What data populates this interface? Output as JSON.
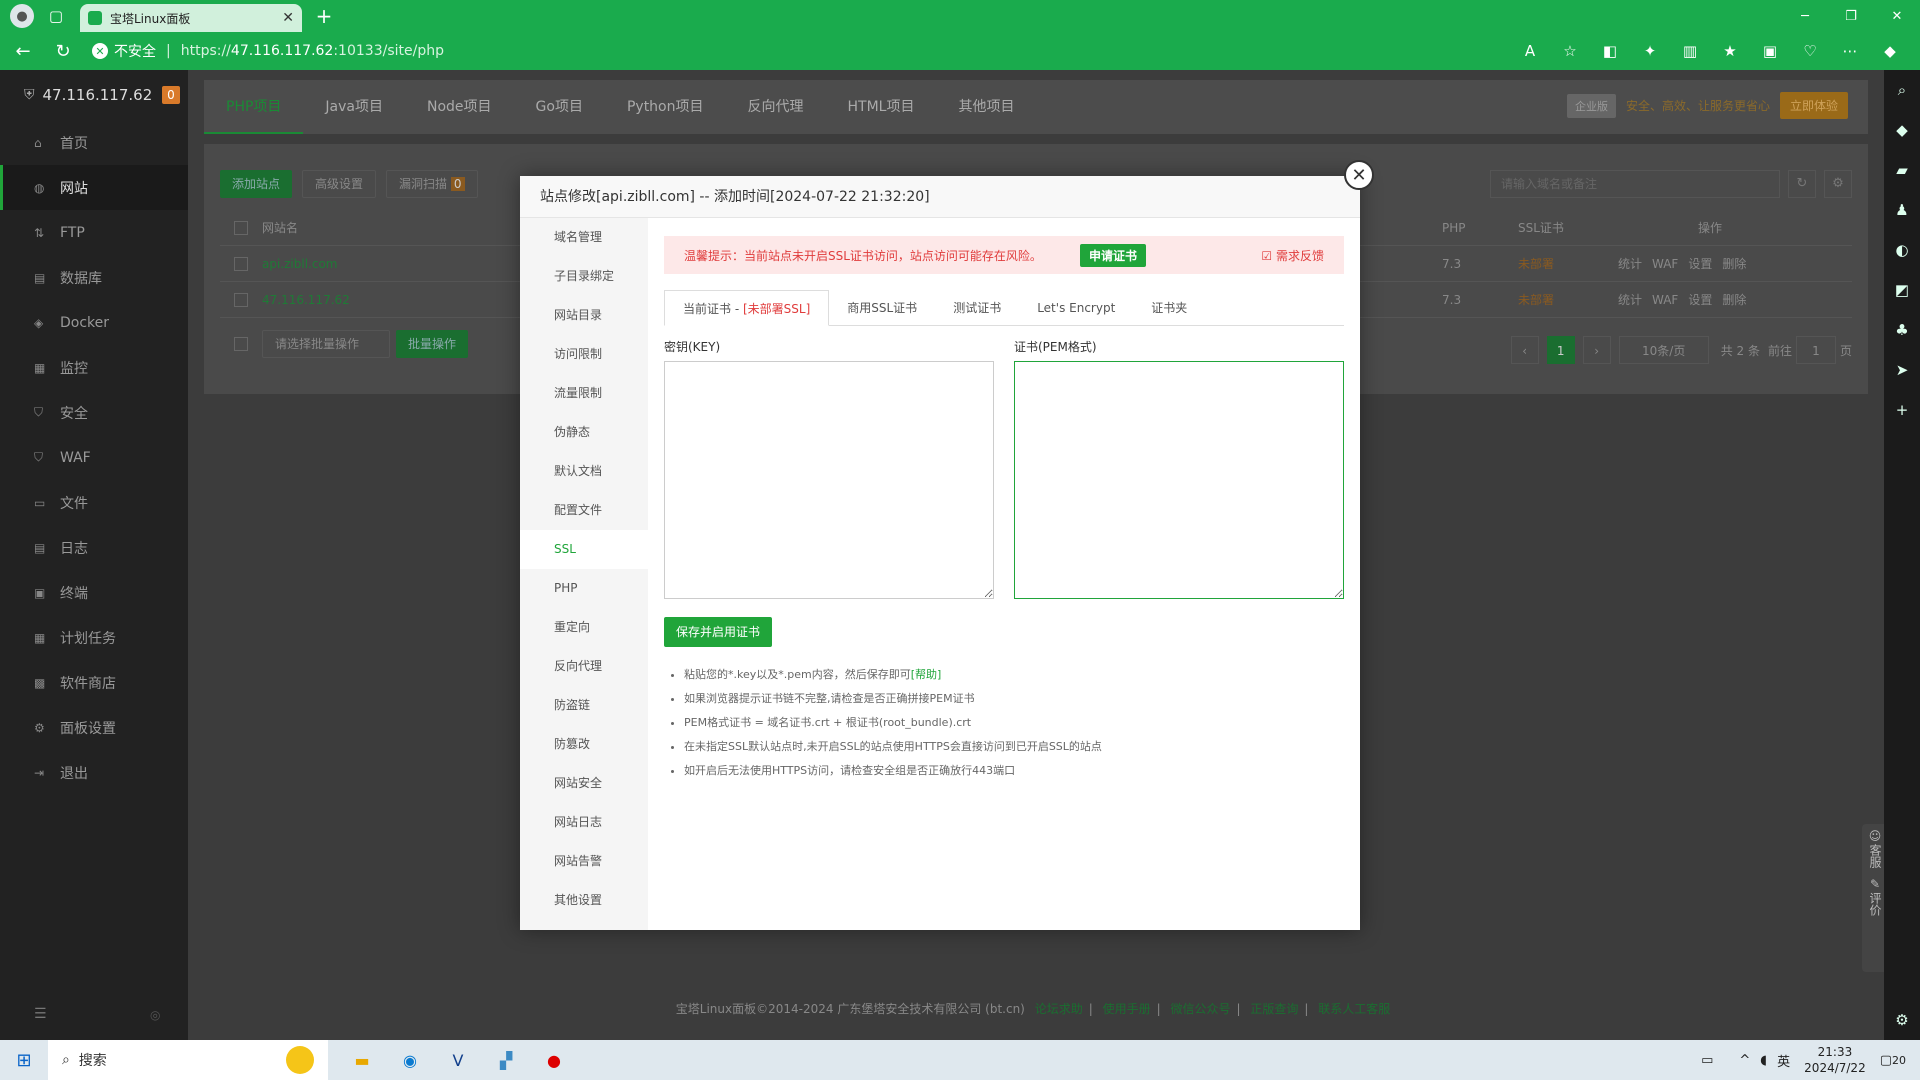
{
  "browser": {
    "tab_title": "宝塔Linux面板",
    "insecure_label": "不安全",
    "url_scheme": "https://",
    "url_host": "47.116.117.62",
    "url_rest": ":10133/site/php"
  },
  "sidebar": {
    "server_ip": "47.116.117.62",
    "badge": "0",
    "items": [
      "首页",
      "网站",
      "FTP",
      "数据库",
      "Docker",
      "监控",
      "安全",
      "WAF",
      "文件",
      "日志",
      "终端",
      "计划任务",
      "软件商店",
      "面板设置",
      "退出"
    ]
  },
  "top_tabs": [
    "PHP项目",
    "Java项目",
    "Node项目",
    "Go项目",
    "Python项目",
    "反向代理",
    "HTML项目",
    "其他项目"
  ],
  "promo": {
    "pro": "企业版",
    "slogan": "安全、高效、让服务更省心",
    "try": "立即体验"
  },
  "toolbar": {
    "add_site": "添加站点",
    "advanced": "高级设置",
    "scan": "漏洞扫描",
    "scan_count": "0",
    "search_placeholder": "请输入域名或备注"
  },
  "table": {
    "headers": {
      "name": "网站名",
      "php": "PHP",
      "ssl": "SSL证书",
      "ops": "操作"
    },
    "rows": [
      {
        "name": "api.zibll.com",
        "php": "7.3",
        "ssl": "未部署",
        "ops": [
          "统计",
          "WAF",
          "设置",
          "删除"
        ]
      },
      {
        "name": "47.116.117.62",
        "php": "7.3",
        "ssl": "未部署",
        "ops": [
          "统计",
          "WAF",
          "设置",
          "删除"
        ]
      }
    ],
    "batch_placeholder": "请选择批量操作",
    "batch_btn": "批量操作"
  },
  "pager": {
    "current": "1",
    "per_page": "10条/页",
    "total": "共 2 条",
    "goto": "前往",
    "goto_val": "1",
    "page": "页"
  },
  "footer": {
    "copyright": "宝塔Linux面板©2014-2024 广东堡塔安全技术有限公司 (bt.cn)",
    "links": [
      "论坛求助",
      "使用手册",
      "微信公众号",
      "正版查询",
      "联系人工客服"
    ]
  },
  "float": {
    "service": "客服",
    "review": "评价"
  },
  "modal": {
    "title": "站点修改[api.zibll.com] -- 添加时间[2024-07-22 21:32:20]",
    "side_items": [
      "域名管理",
      "子目录绑定",
      "网站目录",
      "访问限制",
      "流量限制",
      "伪静态",
      "默认文档",
      "配置文件",
      "SSL",
      "PHP",
      "重定向",
      "反向代理",
      "防盗链",
      "防篡改",
      "网站安全",
      "网站日志",
      "网站告警",
      "其他设置"
    ],
    "alert": "温馨提示：当前站点未开启SSL证书访问，站点访问可能存在风险。",
    "apply_cert": "申请证书",
    "feedback": "需求反馈",
    "ssl_tabs": {
      "current": "当前证书 - ",
      "current_status": "[未部署SSL]",
      "others": [
        "商用SSL证书",
        "测试证书",
        "Let's Encrypt",
        "证书夹"
      ]
    },
    "key_label": "密钥(KEY)",
    "cert_label": "证书(PEM格式)",
    "save_btn": "保存并启用证书",
    "tips": [
      "粘贴您的*.key以及*.pem内容，然后保存即可",
      "如果浏览器提示证书链不完整,请检查是否正确拼接PEM证书",
      "PEM格式证书 = 域名证书.crt + 根证书(root_bundle).crt",
      "在未指定SSL默认站点时,未开启SSL的站点使用HTTPS会直接访问到已开启SSL的站点",
      "如开启后无法使用HTTPS访问，请检查安全组是否正确放行443端口"
    ],
    "help_link": "[帮助]"
  },
  "taskbar": {
    "search": "搜索",
    "ime": "英",
    "time": "21:33",
    "date": "2024/7/22",
    "notif": "20"
  }
}
